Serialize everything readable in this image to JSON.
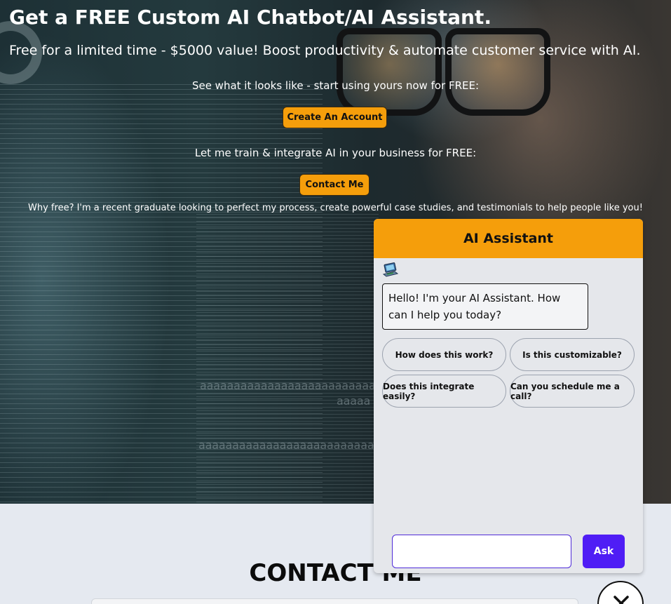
{
  "hero": {
    "title": "Get a FREE Custom AI Chatbot/AI Assistant.",
    "subtitle": "Free for a limited time - $5000 value! Boost productivity & automate customer service with AI.",
    "see_text": "See what it looks like - start using yours now for FREE:",
    "create_account_label": "Create An Account",
    "train_text": "Let me train & integrate AI in your business for FREE:",
    "contact_me_label": "Contact Me",
    "why_free_text": "Why free? I'm a recent graduate looking to perfect my process, create powerful case studies, and testimonials to help people like you!",
    "accent_color": "#f59e0b"
  },
  "contact_section": {
    "title": "CONTACT ME"
  },
  "chat": {
    "header": "AI Assistant",
    "avatar_icon": "laptop-icon",
    "greeting": "Hello! I'm your AI Assistant. How can I help you today?",
    "suggestions": [
      "How does this work?",
      "Is this customizable?",
      "Does this integrate easily?",
      "Can you schedule me a call?"
    ],
    "input_value": "",
    "ask_label": "Ask",
    "ask_color": "#4f1df5",
    "close_icon": "close-icon"
  }
}
